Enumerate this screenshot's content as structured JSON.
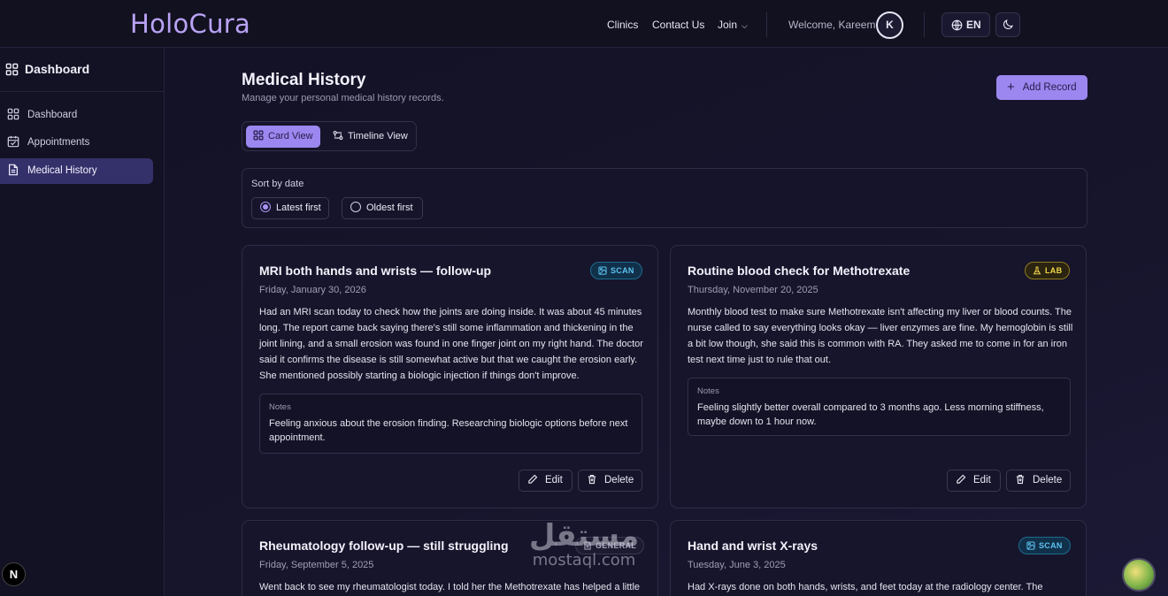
{
  "brand": {
    "logo": "HoloCura"
  },
  "nav": {
    "clinics": "Clinics",
    "contact": "Contact Us",
    "join": "Join",
    "welcome": "Welcome, Kareem",
    "avatar_initial": "K",
    "language": "EN"
  },
  "sidebar": {
    "title": "Dashboard",
    "items": [
      {
        "label": "Dashboard",
        "icon": "grid-icon",
        "active": false
      },
      {
        "label": "Appointments",
        "icon": "calendar-icon",
        "active": false
      },
      {
        "label": "Medical History",
        "icon": "document-icon",
        "active": true
      }
    ]
  },
  "page": {
    "title": "Medical History",
    "subtitle": "Manage your personal medical history records.",
    "add_button": "Add Record"
  },
  "view_toggle": {
    "card": "Card View",
    "timeline": "Timeline View",
    "selected": "card"
  },
  "sort": {
    "label": "Sort by date",
    "options": [
      {
        "label": "Latest first",
        "selected": true
      },
      {
        "label": "Oldest first",
        "selected": false
      }
    ]
  },
  "records": [
    {
      "title": "MRI both hands and wrists — follow-up",
      "badge": "SCAN",
      "date": "Friday, January 30, 2026",
      "body": "Had an MRI scan today to check how the joints are doing inside. It was about 45 minutes long. The report came back saying there's still some inflammation and thickening in the joint lining, and a small erosion was found in one finger joint on my right hand. The doctor said it confirms the disease is still somewhat active but that we caught the erosion early. She mentioned possibly starting a biologic injection if things don't improve.",
      "notes_label": "Notes",
      "notes": "Feeling anxious about the erosion finding. Researching biologic options before next appointment.",
      "edit": "Edit",
      "delete": "Delete"
    },
    {
      "title": "Routine blood check for Methotrexate",
      "badge": "LAB",
      "date": "Thursday, November 20, 2025",
      "body": "Monthly blood test to make sure Methotrexate isn't affecting my liver or blood counts. The nurse called to say everything looks okay — liver enzymes are fine. My hemoglobin is still a bit low though, she said this is common with RA. They asked me to come in for an iron test next time just to rule that out.",
      "notes_label": "Notes",
      "notes": "Feeling slightly better overall compared to 3 months ago. Less morning stiffness, maybe down to 1 hour now.",
      "edit": "Edit",
      "delete": "Delete"
    },
    {
      "title": "Rheumatology follow-up — still struggling",
      "badge": "GENERAL",
      "date": "Friday, September 5, 2025",
      "body": "Went back to see my rheumatologist today. I told her the Methotrexate has helped a little"
    },
    {
      "title": "Hand and wrist X-rays",
      "badge": "SCAN",
      "date": "Tuesday, June 3, 2025",
      "body": "Had X-rays done on both hands, wrists, and feet today at the radiology center. The"
    }
  ],
  "watermark": {
    "arabic": "مستقل",
    "latin": "mostaql.com"
  },
  "next_badge": "N",
  "colors": {
    "accent": "#9c87f0",
    "scan": "#5cc3f0",
    "lab": "#f2d64a",
    "background": "#141226"
  }
}
